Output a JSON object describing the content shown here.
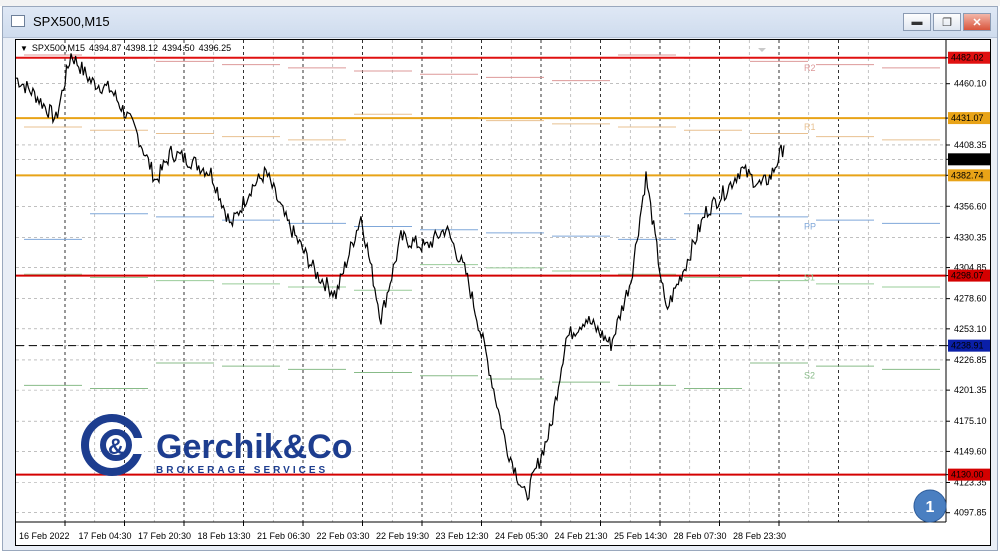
{
  "window": {
    "title": "SPX500,M15",
    "controls": [
      "minimize",
      "restore",
      "close"
    ]
  },
  "chart": {
    "info": {
      "symbol": "SPX500,M15",
      "open": "4394.87",
      "high": "4398.12",
      "low": "4394.50",
      "close": "4396.25"
    },
    "price_axis": [
      "4482.02",
      "4460.10",
      "4431.07",
      "4408.35",
      "4396.25",
      "4382.74",
      "4356.60",
      "4330.35",
      "4304.85",
      "4298.07",
      "4278.60",
      "4253.10",
      "4238.91",
      "4226.85",
      "4201.35",
      "4175.10",
      "4149.60",
      "4130.00",
      "4123.35",
      "4097.85"
    ],
    "time_axis": [
      "16 Feb 2022",
      "17 Feb 04:30",
      "17 Feb 20:30",
      "18 Feb 13:30",
      "21 Feb 06:30",
      "22 Feb 03:30",
      "22 Feb 19:30",
      "23 Feb 12:30",
      "24 Feb 05:30",
      "24 Feb 21:30",
      "25 Feb 14:30",
      "28 Feb 07:30",
      "28 Feb 23:30"
    ],
    "levels": [
      {
        "price": 4482.02,
        "label": "4482.02",
        "color": "#e01010"
      },
      {
        "price": 4431.07,
        "label": "4431.07",
        "color": "#e8a317"
      },
      {
        "price": 4382.74,
        "label": "4382.74",
        "color": "#e8a317"
      },
      {
        "price": 4298.07,
        "label": "4298.07",
        "color": "#d40000"
      },
      {
        "price": 4238.91,
        "label": "4238.91",
        "color": "#0a1fa8"
      },
      {
        "price": 4130.0,
        "label": "4130.00",
        "color": "#d40000"
      }
    ],
    "current_price": {
      "label": "4396.25",
      "color": "#000000"
    },
    "pivots": [
      {
        "name": "R2",
        "price": 4473.5
      },
      {
        "name": "R1",
        "price": 4423.5
      },
      {
        "name": "PP",
        "price": 4339.5
      },
      {
        "name": "S1",
        "price": 4296.5
      },
      {
        "name": "S2",
        "price": 4213.5
      }
    ],
    "watermark": {
      "brand": "Gerchik&Co",
      "tagline": "BROKERAGE SERVICES"
    },
    "badge": "1"
  }
}
